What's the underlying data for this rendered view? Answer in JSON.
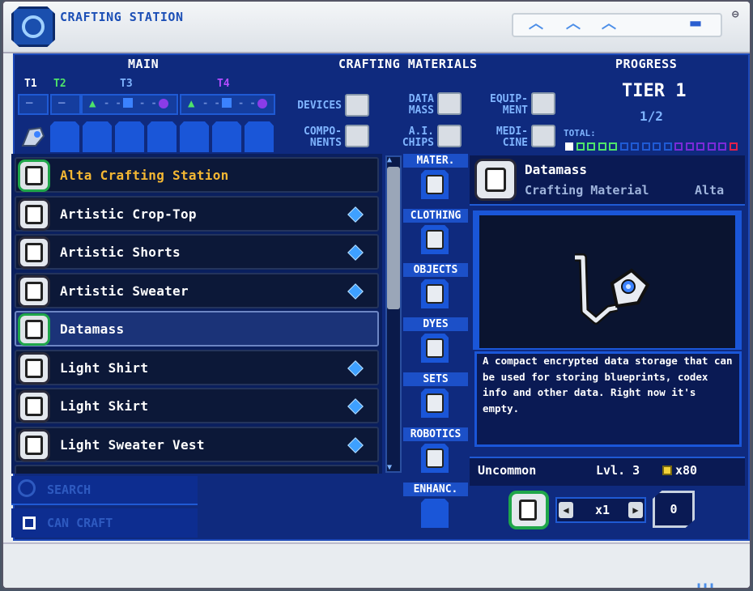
{
  "window": {
    "title": "CRAFTING STATION"
  },
  "header": {
    "main_label": "MAIN",
    "materials_label": "CRAFTING MATERIALS",
    "progress_label": "PROGRESS",
    "tiers": [
      "T1",
      "T2",
      "T3",
      "T4"
    ],
    "tier_colors": [
      "#ffffff",
      "#4ee36a",
      "#7fb4ff",
      "#b24cff"
    ],
    "categories": [
      {
        "label_line1": "DEVICES",
        "label_line2": "",
        "icon": "device-icon"
      },
      {
        "label_line1": "COMPO-",
        "label_line2": "NENTS",
        "icon": "components-icon"
      },
      {
        "label_line1": "DATA",
        "label_line2": "MASS",
        "icon": "datamass-icon"
      },
      {
        "label_line1": "A.I.",
        "label_line2": "CHIPS",
        "icon": "ai-chip-icon"
      },
      {
        "label_line1": "EQUIP-",
        "label_line2": "MENT",
        "icon": "equipment-icon"
      },
      {
        "label_line1": "MEDI-",
        "label_line2": "CINE",
        "icon": "medicine-icon"
      }
    ]
  },
  "progress": {
    "tier_text": "TIER 1",
    "fraction_text": "1/2",
    "total_label": "TOTAL:",
    "box_colors": [
      "#ffffff",
      "#4ee36a",
      "#4ee36a",
      "#4ee36a",
      "#4ee36a",
      "#1f5ad4",
      "#1f5ad4",
      "#1f5ad4",
      "#1f5ad4",
      "#1f5ad4",
      "#7a2ad8",
      "#7a2ad8",
      "#7a2ad8",
      "#7a2ad8",
      "#7a2ad8",
      "#e0204a"
    ]
  },
  "recipes": [
    {
      "name": "Alta Crafting Station",
      "highlight": true,
      "craftable": true,
      "new": false
    },
    {
      "name": "Artistic Crop-Top",
      "highlight": false,
      "craftable": false,
      "new": true
    },
    {
      "name": "Artistic Shorts",
      "highlight": false,
      "craftable": false,
      "new": true
    },
    {
      "name": "Artistic Sweater",
      "highlight": false,
      "craftable": false,
      "new": true
    },
    {
      "name": "Datamass",
      "highlight": false,
      "craftable": true,
      "new": false,
      "selected": true
    },
    {
      "name": "Light Shirt",
      "highlight": false,
      "craftable": false,
      "new": true
    },
    {
      "name": "Light Skirt",
      "highlight": false,
      "craftable": false,
      "new": true
    },
    {
      "name": "Light Sweater Vest",
      "highlight": false,
      "craftable": false,
      "new": true
    }
  ],
  "filters": {
    "search_placeholder": "SEARCH",
    "can_craft_label": "CAN CRAFT"
  },
  "tabs": [
    {
      "label": "MATER.",
      "icon": "material-icon"
    },
    {
      "label": "CLOTHING",
      "icon": "clothing-icon"
    },
    {
      "label": "OBJECTS",
      "icon": "objects-icon"
    },
    {
      "label": "DYES",
      "icon": "dye-icon"
    },
    {
      "label": "SETS",
      "icon": "sets-icon"
    },
    {
      "label": "ROBOTICS",
      "icon": "robotics-icon"
    },
    {
      "label": "ENHANC.",
      "icon": "enhancement-icon"
    }
  ],
  "detail": {
    "name": "Datamass",
    "type": "Crafting Material",
    "brand": "Alta",
    "description": "A compact encrypted data storage that can be used for storing blueprints, codex info and other data. Right now it's empty.",
    "rarity": "Uncommon",
    "level": "Lvl. 3",
    "price": "x80"
  },
  "craft": {
    "quantity": "x1",
    "count": "0"
  }
}
